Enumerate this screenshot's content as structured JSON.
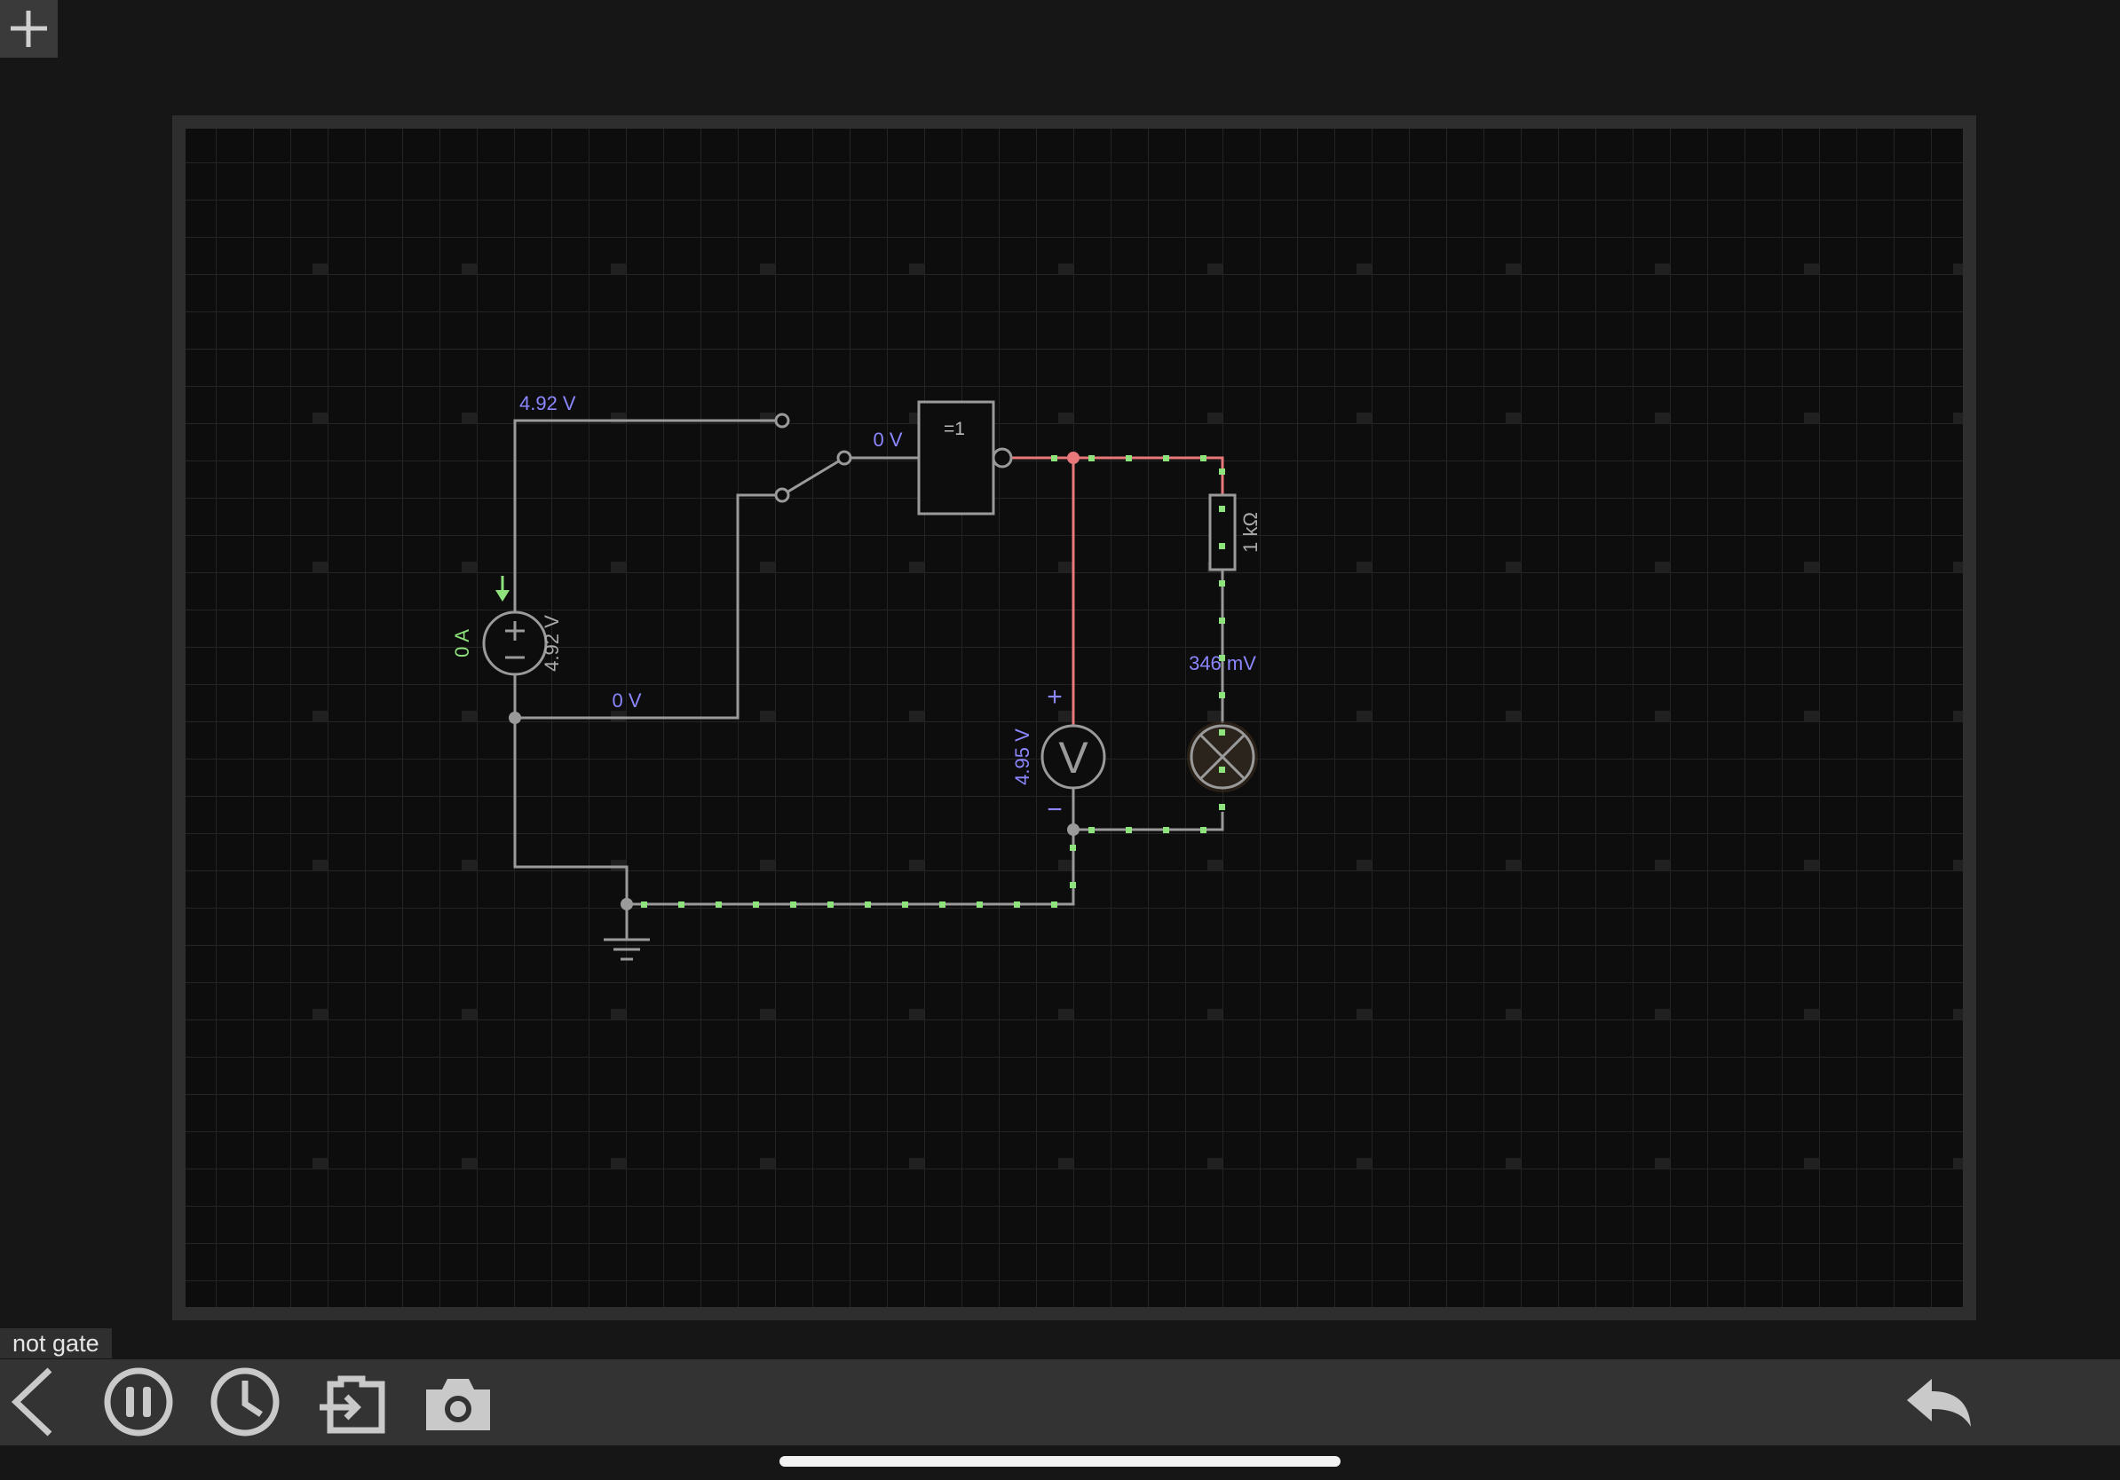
{
  "app": {
    "circuit_name": "not gate"
  },
  "toolbar": {
    "add_icon": "plus-icon",
    "back_icon": "chevron-left-icon",
    "pause_icon": "pause-circle-icon",
    "speed_icon": "clock-icon",
    "export_icon": "export-icon",
    "screenshot_icon": "camera-icon",
    "undo_icon": "undo-icon"
  },
  "circuit": {
    "supply_voltage_label": "4.92 V",
    "supply_wire_label": "4.92 V",
    "supply_current_label": "0 A",
    "ground_wire_label": "0 V",
    "gate_input_label": "0 V",
    "gate_symbol": "=1",
    "resistor_label": "1 kΩ",
    "lamp_voltage_label": "346 mV",
    "voltmeter_reading": "4.95 V",
    "voltmeter_symbol": "V",
    "voltmeter_plus": "+",
    "voltmeter_minus": "−"
  },
  "colors": {
    "background": "#161616",
    "board": "#0d0d0d",
    "wire": "#9a9a9a",
    "high_wire": "#e8787a",
    "current_dot": "#8ee37c",
    "label_blue": "#8c86ff",
    "label_green": "#8ee37c"
  }
}
